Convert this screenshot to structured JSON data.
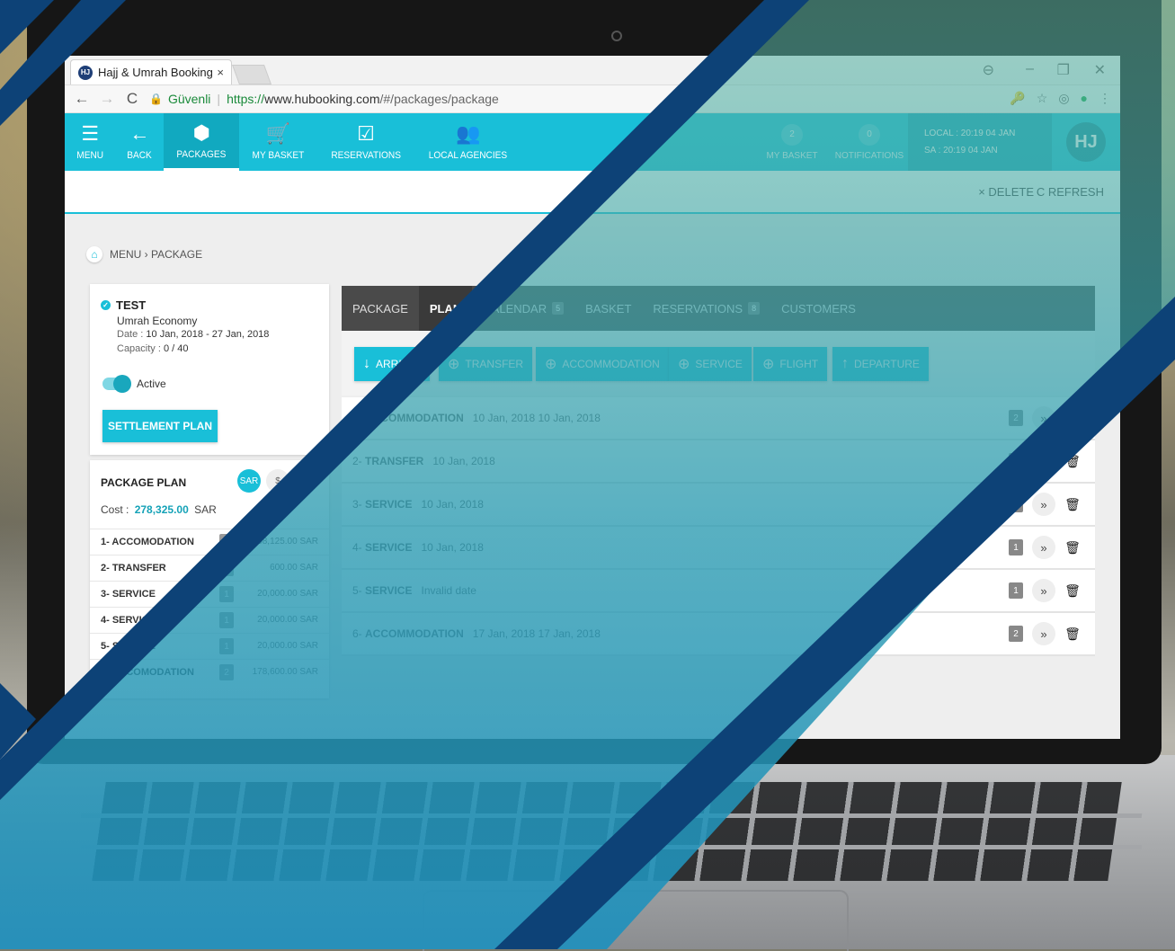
{
  "browser": {
    "tab_title": "Hajj & Umrah Booking",
    "tab_close": "×",
    "favicon_text": "HJ",
    "secure_label": "Güvenli",
    "url_proto": "https://",
    "url_host": "www.hubooking.com",
    "url_path": "/#/packages/package"
  },
  "nav": {
    "items": [
      {
        "label": "MENU",
        "icon": "☰"
      },
      {
        "label": "BACK",
        "icon": "←"
      },
      {
        "label": "PACKAGES",
        "icon": "⬢"
      },
      {
        "label": "MY BASKET",
        "icon": "🛒"
      },
      {
        "label": "RESERVATIONS",
        "icon": "☑"
      },
      {
        "label": "LOCAL AGENCIES",
        "icon": "👥"
      }
    ],
    "basket_count": "2",
    "basket_label": "MY BASKET",
    "notif_count": "0",
    "notif_label": "NOTIFICATIONS",
    "local_time": "LOCAL : 20:19  04 JAN",
    "sa_time": "SA : 20:19  04 JAN",
    "logo": "HJ"
  },
  "toolbar": {
    "delete_label": "× DELETE",
    "refresh_label": "C REFRESH"
  },
  "breadcrumb": "MENU › PACKAGE",
  "package": {
    "title": "TEST",
    "subtitle": "Umrah   Economy",
    "date_label": "Date :",
    "date_value": "10 Jan, 2018 - 27 Jan, 2018",
    "capacity_label": "Capacity :",
    "capacity_value": "0 / 40",
    "active_label": "Active",
    "settlement_button": "SETTLEMENT PLAN"
  },
  "plan": {
    "heading": "PACKAGE PLAN",
    "cur_sar": "SAR",
    "cur_usd": "$",
    "cost_label": "Cost :",
    "cost_value": "278,325.00",
    "cost_currency": "SAR",
    "items": [
      {
        "name": "1- ACCOMODATION",
        "count": "2",
        "price": "58,125.00 SAR"
      },
      {
        "name": "2- TRANSFER",
        "count": "1",
        "price": "600.00 SAR"
      },
      {
        "name": "3- SERVICE",
        "count": "1",
        "price": "20,000.00 SAR"
      },
      {
        "name": "4- SERVICE",
        "count": "1",
        "price": "20,000.00 SAR"
      },
      {
        "name": "5- SERVICE",
        "count": "1",
        "price": "20,000.00 SAR"
      },
      {
        "name": "6- ACCOMODATION",
        "count": "2",
        "price": "178,600.00 SAR"
      }
    ]
  },
  "tabs": [
    {
      "label": "PACKAGE",
      "count": ""
    },
    {
      "label": "PLAN",
      "count": ""
    },
    {
      "label": "CALENDAR",
      "count": "5"
    },
    {
      "label": "BASKET",
      "count": ""
    },
    {
      "label": "RESERVATIONS",
      "count": "8"
    },
    {
      "label": "CUSTOMERS",
      "count": ""
    }
  ],
  "actions": [
    {
      "label": "ARRIVAL",
      "icon": "↓"
    },
    {
      "label": "TRANSFER",
      "icon": "⊕"
    },
    {
      "label": "ACCOMMODATION",
      "icon": "⊕"
    },
    {
      "label": "SERVICE",
      "icon": "⊕"
    },
    {
      "label": "FLIGHT",
      "icon": "⊕"
    },
    {
      "label": "DEPARTURE",
      "icon": "↑"
    }
  ],
  "rows": [
    {
      "idx": "1-",
      "type": "ACCOMMODATION",
      "date": "10 Jan, 2018   10 Jan, 2018",
      "count": "2"
    },
    {
      "idx": "2-",
      "type": "TRANSFER",
      "date": "10 Jan, 2018",
      "count": "1"
    },
    {
      "idx": "3-",
      "type": "SERVICE",
      "date": "10 Jan, 2018",
      "count": "1"
    },
    {
      "idx": "4-",
      "type": "SERVICE",
      "date": "10 Jan, 2018",
      "count": "1"
    },
    {
      "idx": "5-",
      "type": "SERVICE",
      "date": "Invalid date",
      "count": "1"
    },
    {
      "idx": "6-",
      "type": "ACCOMMODATION",
      "date": "17 Jan, 2018   17 Jan, 2018",
      "count": "2"
    }
  ],
  "colors": {
    "accent": "#19bfd8",
    "navy": "#0d4277",
    "tabs_dark": "#4a4a4a"
  }
}
